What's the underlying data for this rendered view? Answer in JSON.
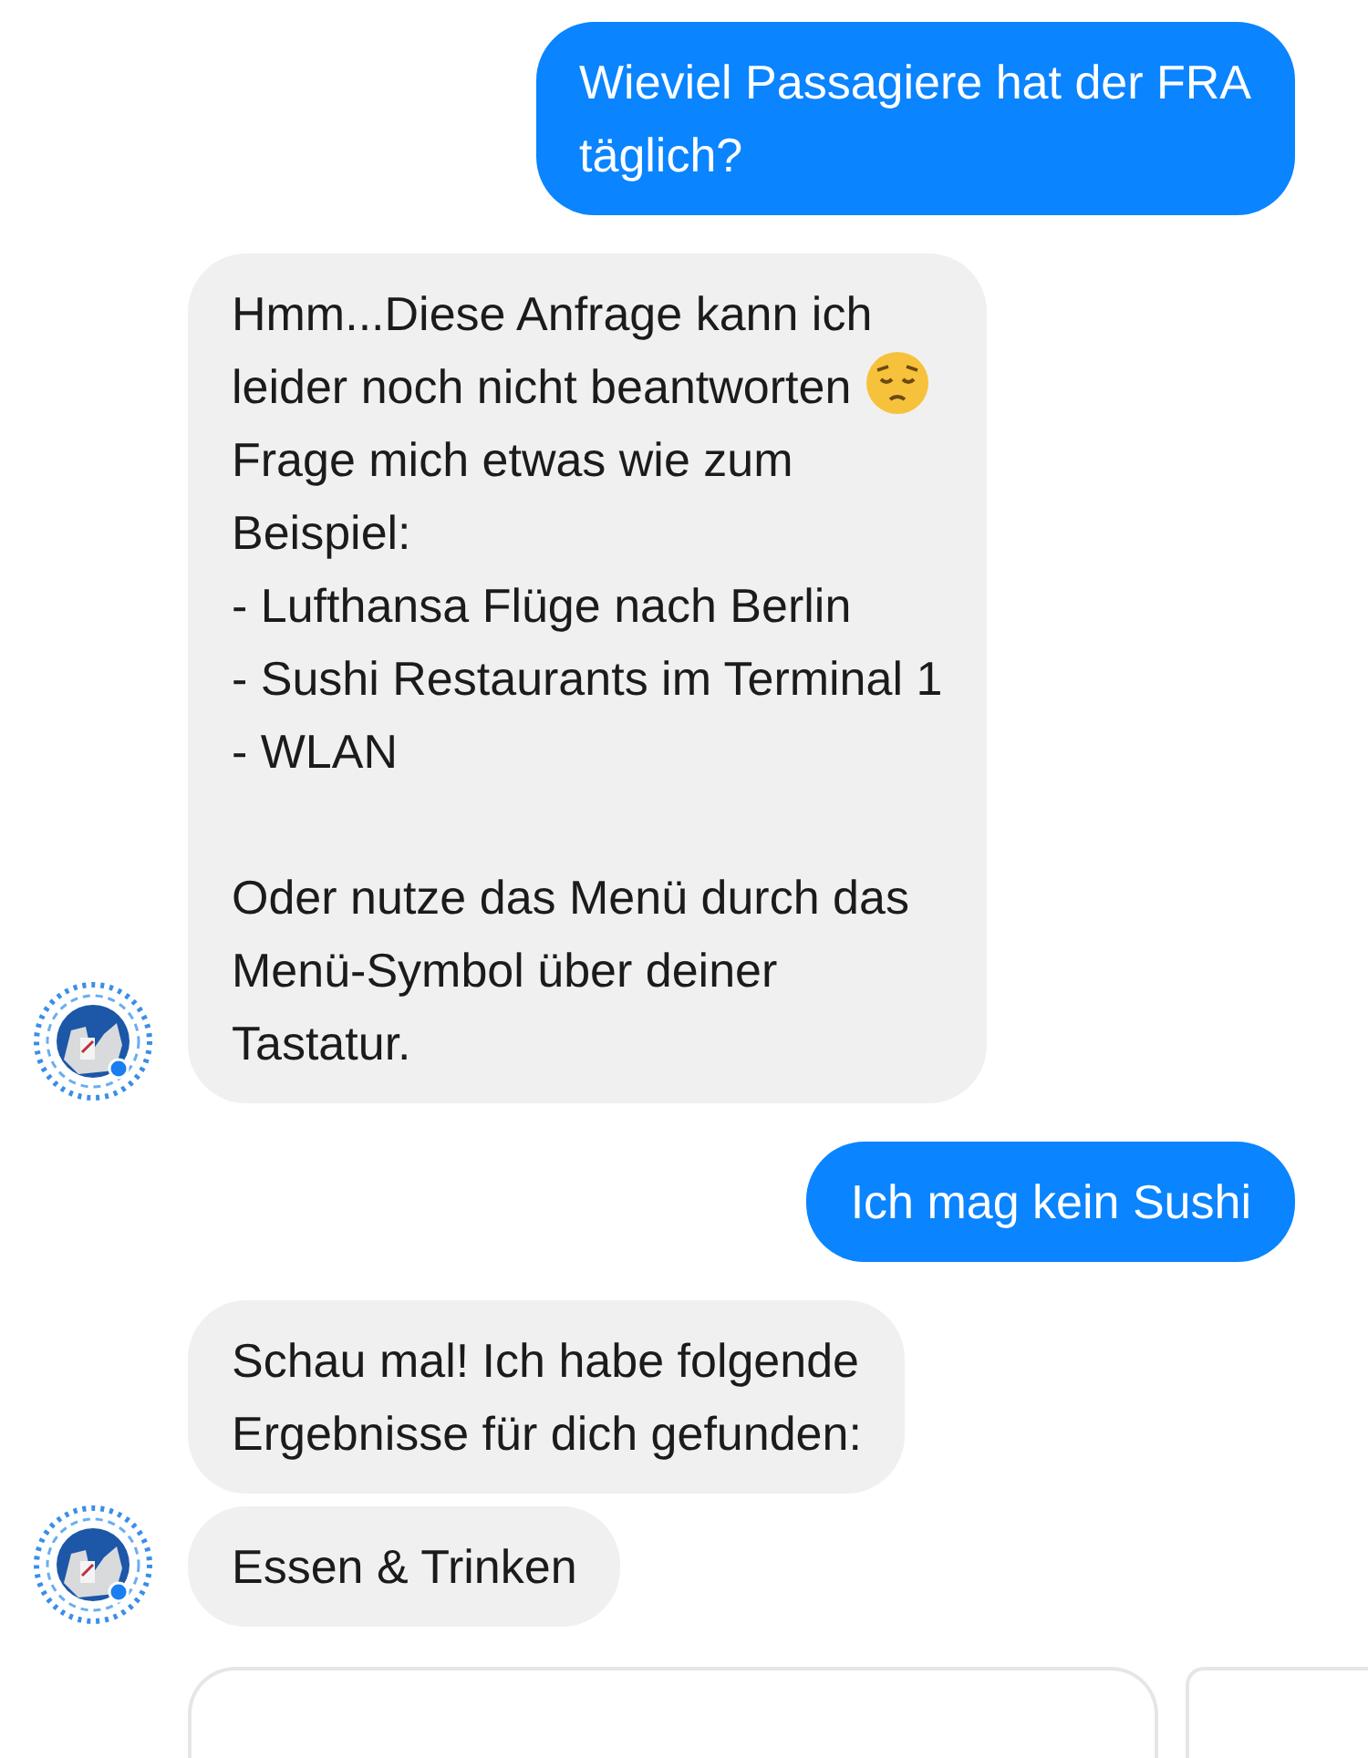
{
  "messages": [
    {
      "kind": "user",
      "parts": [
        {
          "kind": "text",
          "text": "Wieviel Passagiere hat der FRA\ntäglich?"
        }
      ]
    },
    {
      "kind": "bot",
      "avatar": true,
      "parts": [
        {
          "kind": "text",
          "text": "Hmm...Diese Anfrage kann ich\nleider noch nicht beantworten "
        },
        {
          "kind": "pensive-emoji"
        },
        {
          "kind": "text",
          "text": "\nFrage mich etwas wie zum\nBeispiel:\n- Lufthansa Flüge nach Berlin\n- Sushi Restaurants im Terminal 1\n- WLAN\n\nOder nutze das Menü durch das\nMenü-Symbol über deiner\nTastatur."
        }
      ]
    },
    {
      "kind": "user",
      "parts": [
        {
          "kind": "text",
          "text": "Ich mag kein Sushi"
        }
      ]
    },
    {
      "kind": "bot",
      "avatar": false,
      "parts": [
        {
          "kind": "text",
          "text": "Schau mal! Ich habe folgende\nErgebnisse für dich gefunden:"
        }
      ]
    },
    {
      "kind": "bot",
      "avatar": true,
      "parts": [
        {
          "kind": "text",
          "text": "Essen & Trinken"
        }
      ]
    }
  ],
  "cards": [
    {
      "kind": "card"
    },
    {
      "kind": "card"
    }
  ]
}
